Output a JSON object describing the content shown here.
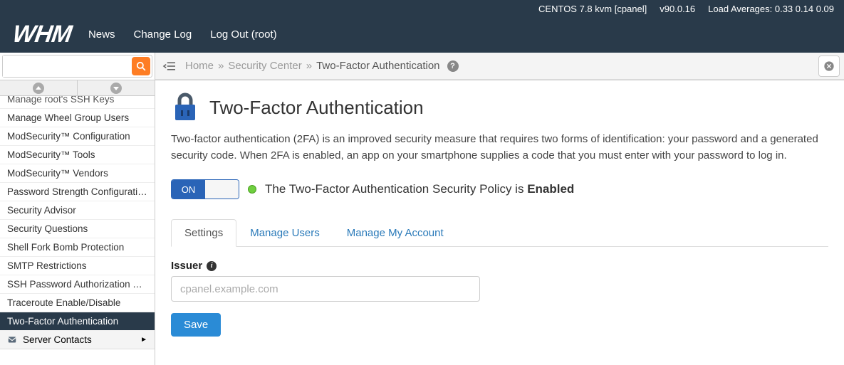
{
  "topbar": {
    "os": "CENTOS 7.8 kvm [cpanel]",
    "version": "v90.0.16",
    "load": "Load Averages: 0.33 0.14 0.09",
    "logo": "WHM",
    "nav": {
      "news": "News",
      "changelog": "Change Log",
      "logout": "Log Out (root)"
    }
  },
  "breadcrumb": {
    "home": "Home",
    "section": "Security Center",
    "page": "Two-Factor Authentication"
  },
  "sidebar": {
    "items": [
      "Manage root's SSH Keys",
      "Manage Wheel Group Users",
      "ModSecurity™ Configuration",
      "ModSecurity™ Tools",
      "ModSecurity™ Vendors",
      "Password Strength Configuration",
      "Security Advisor",
      "Security Questions",
      "Shell Fork Bomb Protection",
      "SMTP Restrictions",
      "SSH Password Authorization Tweak",
      "Traceroute Enable/Disable",
      "Two-Factor Authentication"
    ],
    "category": "Server Contacts"
  },
  "page": {
    "title": "Two-Factor Authentication",
    "description": "Two-factor authentication (2FA) is an improved security measure that requires two forms of identification: your password and a generated security code. When 2FA is enabled, an app on your smartphone supplies a code that you must enter with your password to log in.",
    "toggle_on": "ON",
    "status_prefix": "The Two-Factor Authentication Security Policy is ",
    "status_state": "Enabled",
    "tabs": {
      "settings": "Settings",
      "manage_users": "Manage Users",
      "manage_account": "Manage My Account"
    },
    "issuer_label": "Issuer",
    "issuer_placeholder": "cpanel.example.com",
    "save": "Save"
  }
}
